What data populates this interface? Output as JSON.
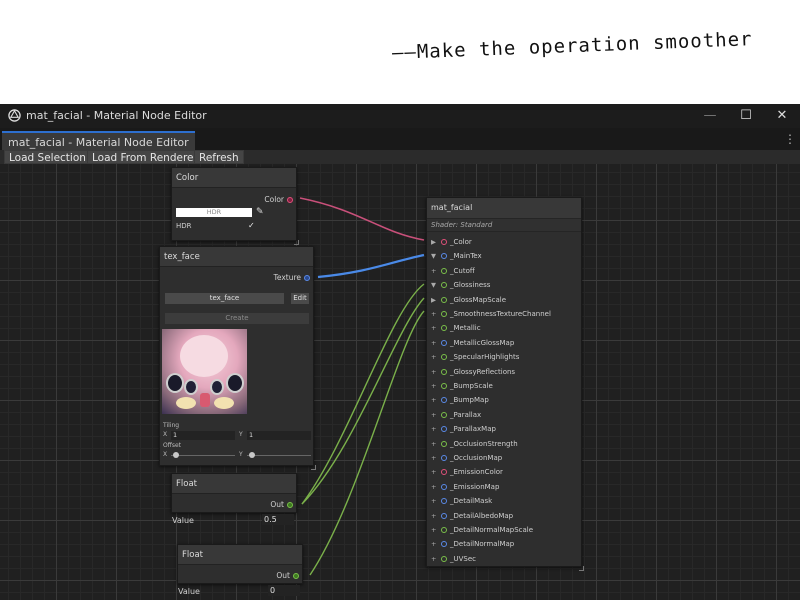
{
  "tagline": "——Make the operation smoother",
  "window": {
    "title": "mat_facial - Material Node Editor",
    "tab_label": "mat_facial - Material Node Editor",
    "tab_menu_glyph": "⋮",
    "controls": {
      "minimize": "—",
      "maximize": "☐",
      "close": "✕"
    }
  },
  "toolbar": {
    "load_selection": "Load Selection",
    "load_from_renderer": "Load From Renderer",
    "refresh": "Refresh"
  },
  "nodes": {
    "color": {
      "title": "Color",
      "out_label": "Color",
      "field_text": "HDR",
      "hdr_label": "HDR",
      "hdr_checked_glyph": "✓"
    },
    "tex": {
      "title": "tex_face",
      "out_label": "Texture",
      "texture_name": "tex_face",
      "edit_label": "Edit",
      "create_label": "Create",
      "tiling_label": "Tiling",
      "tiling_x_label": "X",
      "tiling_x": "1",
      "tiling_y_label": "Y",
      "tiling_y": "1",
      "offset_label": "Offset",
      "offset_x_label": "X",
      "offset_y_label": "Y"
    },
    "float1": {
      "title": "Float",
      "out_label": "Out",
      "value_label": "Value",
      "value": "0.5"
    },
    "float2": {
      "title": "Float",
      "out_label": "Out",
      "value_label": "Value",
      "value": "0"
    }
  },
  "material": {
    "title": "mat_facial",
    "shader": "Shader: Standard",
    "properties": [
      {
        "name": "_Color",
        "expander": "▶",
        "dot": "#e0507a"
      },
      {
        "name": "_MainTex",
        "expander": "▼",
        "dot": "#5a8ae8"
      },
      {
        "name": "_Cutoff",
        "expander": "+",
        "dot": "#7ac04a"
      },
      {
        "name": "_Glossiness",
        "expander": "▼",
        "dot": "#7ac04a"
      },
      {
        "name": "_GlossMapScale",
        "expander": "▶",
        "dot": "#7ac04a"
      },
      {
        "name": "_SmoothnessTextureChannel",
        "expander": "+",
        "dot": "#7ac04a"
      },
      {
        "name": "_Metallic",
        "expander": "+",
        "dot": "#7ac04a"
      },
      {
        "name": "_MetallicGlossMap",
        "expander": "+",
        "dot": "#5a8ae8"
      },
      {
        "name": "_SpecularHighlights",
        "expander": "+",
        "dot": "#7ac04a"
      },
      {
        "name": "_GlossyReflections",
        "expander": "+",
        "dot": "#7ac04a"
      },
      {
        "name": "_BumpScale",
        "expander": "+",
        "dot": "#7ac04a"
      },
      {
        "name": "_BumpMap",
        "expander": "+",
        "dot": "#5a8ae8"
      },
      {
        "name": "_Parallax",
        "expander": "+",
        "dot": "#7ac04a"
      },
      {
        "name": "_ParallaxMap",
        "expander": "+",
        "dot": "#5a8ae8"
      },
      {
        "name": "_OcclusionStrength",
        "expander": "+",
        "dot": "#7ac04a"
      },
      {
        "name": "_OcclusionMap",
        "expander": "+",
        "dot": "#5a8ae8"
      },
      {
        "name": "_EmissionColor",
        "expander": "+",
        "dot": "#e0507a"
      },
      {
        "name": "_EmissionMap",
        "expander": "+",
        "dot": "#5a8ae8"
      },
      {
        "name": "_DetailMask",
        "expander": "+",
        "dot": "#5a8ae8"
      },
      {
        "name": "_DetailAlbedoMap",
        "expander": "+",
        "dot": "#5a8ae8"
      },
      {
        "name": "_DetailNormalMapScale",
        "expander": "+",
        "dot": "#7ac04a"
      },
      {
        "name": "_DetailNormalMap",
        "expander": "+",
        "dot": "#5a8ae8"
      },
      {
        "name": "_UVSec",
        "expander": "+",
        "dot": "#7ac04a"
      }
    ]
  },
  "colors": {
    "wire_color": "#c8507a",
    "wire_texture": "#4a8ae8",
    "wire_float": "#7ab04a",
    "accent": "#2d6fcf"
  },
  "icons": [
    "unity-logo-icon",
    "eyedropper-icon",
    "checkmark-icon",
    "expand-arrow-icon"
  ]
}
